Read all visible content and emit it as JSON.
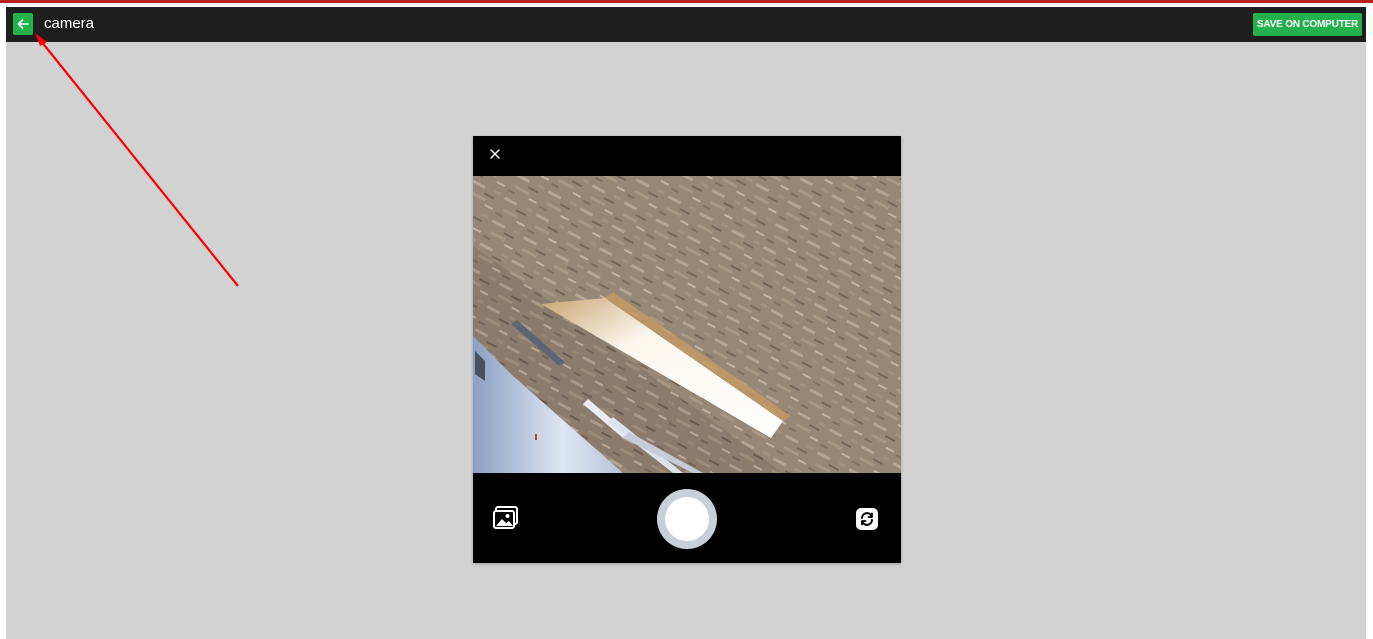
{
  "header": {
    "title": "camera",
    "save_label": "SAVE ON COMPUTER"
  },
  "icons": {
    "back": "arrow-left-icon",
    "close": "close-icon",
    "gallery": "gallery-icon",
    "shutter": "shutter-icon",
    "switch": "switch-camera-icon"
  },
  "colors": {
    "accent": "#22b14c",
    "topbar": "#1e1e1e",
    "workspace": "#d2d2d2",
    "top_border": "#b8201e",
    "annotation_arrow": "#ff0000"
  }
}
